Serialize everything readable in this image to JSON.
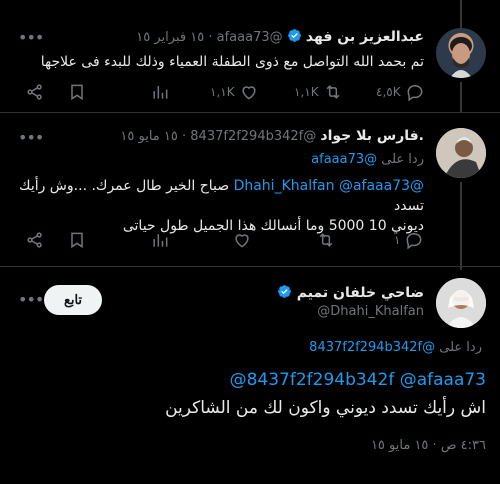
{
  "tweets": [
    {
      "name": "عبدالعزيز بن فهد",
      "handle": "@afaaa73",
      "dot": "·",
      "date": "١٥ فبراير ١٥",
      "text": "تم بحمد الله التواصل مع ذوى الطفلة العمياء وذلك للبدء فى علاجها",
      "metrics": {
        "replies": "٤,٥K",
        "retweets": "١,١K",
        "likes": "١,١K"
      }
    },
    {
      "name": ".فارس بلا جواد",
      "handle": "@8437f2f294b342f",
      "dot": "·",
      "date": "١٥ مايو ١٥",
      "reply_prefix": "ردا على",
      "reply_to": "@afaaa73",
      "mention1": "@Dhahi_Khalfan",
      "mention2": "@afaaa73",
      "text_line1": "صباح الخير طال عمرك. ...وش رأيك تسدد",
      "text_line2": "ديوني 10 5000 وما أنسالك هذا الجميل طول حياتى",
      "metrics": {
        "replies": "١"
      }
    }
  ],
  "main": {
    "name": "ضاحي خلفان تميم",
    "handle": "@Dhahi_Khalfan",
    "follow_label": "تابع",
    "reply_prefix": "ردا على",
    "reply_to": "@8437f2f294b342f",
    "mention_line": "@8437f2f294b342f @afaaa73",
    "text": "اش  رأيك تسدد ديوني  واكون لك من الشاكرين",
    "timestamp": "٤:٣٦ ص · ١٥ مايو ١٥"
  },
  "colors": {
    "background": "#000000",
    "link": "#1d9bf0",
    "muted": "#71767b",
    "verified": "#1d9bf0"
  }
}
